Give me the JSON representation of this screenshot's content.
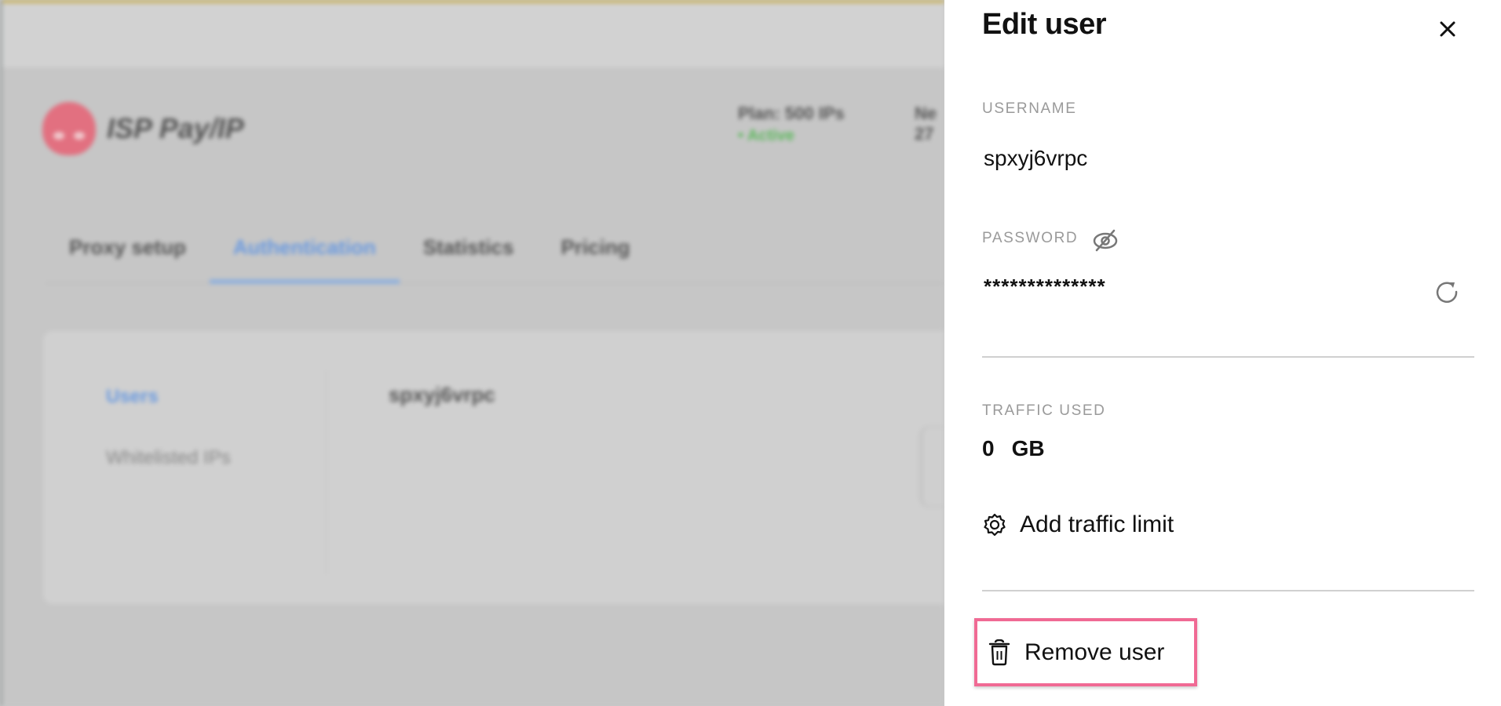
{
  "background": {
    "brand": "ISP Pay/IP",
    "plan_label": "Plan: 500 IPs",
    "plan_status": "• Active",
    "next_label_partial": "Ne",
    "next_value_partial": "27",
    "tabs": [
      {
        "label": "Proxy setup",
        "active": false
      },
      {
        "label": "Authentication",
        "active": true
      },
      {
        "label": "Statistics",
        "active": false
      },
      {
        "label": "Pricing",
        "active": false
      }
    ],
    "auth_nav": [
      {
        "label": "Users",
        "active": true
      },
      {
        "label": "Whitelisted IPs",
        "active": false
      }
    ],
    "user_list": [
      "spxyj6vrpc"
    ]
  },
  "drawer": {
    "title": "Edit user",
    "close_icon": "close-icon",
    "username_label": "USERNAME",
    "username_value": "spxyj6vrpc",
    "password_label": "PASSWORD",
    "password_visibility_icon": "eye-off-icon",
    "password_value": "**************",
    "regenerate_icon": "refresh-icon",
    "traffic_label": "TRAFFIC USED",
    "traffic_value": "0",
    "traffic_unit": "GB",
    "add_limit_icon": "gear-icon",
    "add_limit_label": "Add traffic limit",
    "remove_icon": "trash-icon",
    "remove_label": "Remove user"
  },
  "colors": {
    "accent": "#6a9ae0",
    "active_status": "#5cb85c",
    "highlight_border": "#f06a94",
    "brand": "#e27080"
  }
}
